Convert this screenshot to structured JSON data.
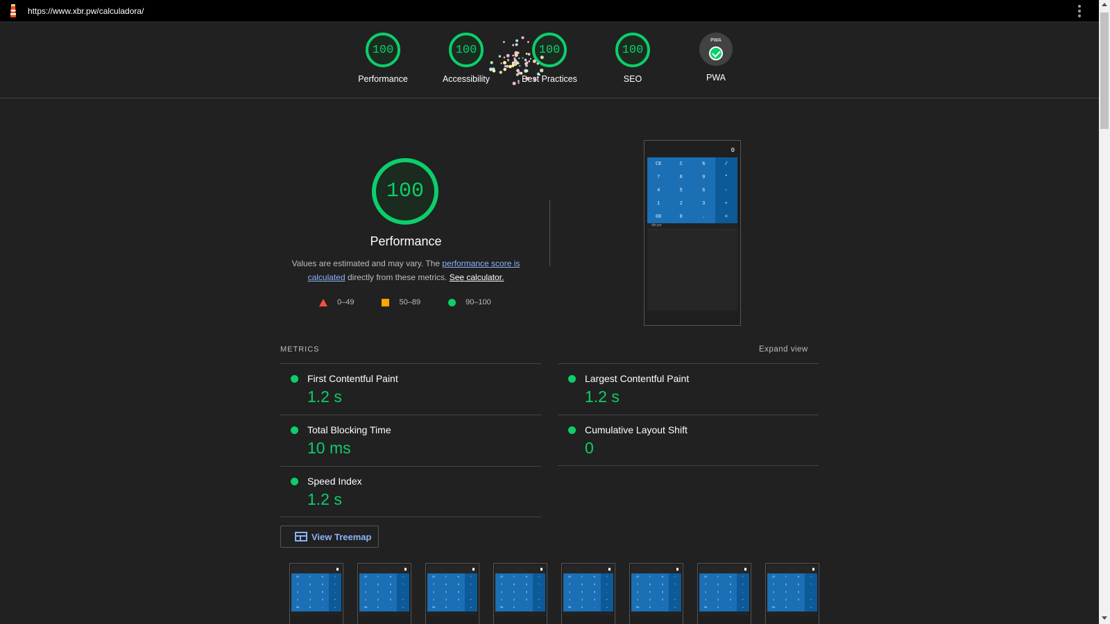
{
  "topbar": {
    "url": "https://www.xbr.pw/calculadora/"
  },
  "header": {
    "categories": [
      {
        "label": "Performance",
        "score": "100"
      },
      {
        "label": "Accessibility",
        "score": "100"
      },
      {
        "label": "Best Practices",
        "score": "100"
      },
      {
        "label": "SEO",
        "score": "100"
      },
      {
        "label": "PWA",
        "badge": "PWA"
      }
    ]
  },
  "performance": {
    "score": "100",
    "title": "Performance",
    "desc_prefix": "Values are estimated and may vary. The ",
    "desc_link": "performance score is calculated",
    "desc_mid": " directly from these metrics. ",
    "desc_link2": "See calculator.",
    "legend": {
      "fail": "0–49",
      "average": "50–89",
      "pass": "90–100"
    }
  },
  "preview": {
    "display": "0",
    "keys": [
      "CE",
      "C",
      "%",
      "/",
      "7",
      "8",
      "9",
      "*",
      "4",
      "5",
      "6",
      "-",
      "1",
      "2",
      "3",
      "+",
      "00",
      "0",
      ".",
      "="
    ],
    "footer": "xbr.pw"
  },
  "metrics": {
    "heading": "METRICS",
    "expand_label": "Expand view",
    "items": [
      {
        "name": "First Contentful Paint",
        "value": "1.2 s"
      },
      {
        "name": "Largest Contentful Paint",
        "value": "1.2 s"
      },
      {
        "name": "Total Blocking Time",
        "value": "10 ms"
      },
      {
        "name": "Cumulative Layout Shift",
        "value": "0"
      },
      {
        "name": "Speed Index",
        "value": "1.2 s"
      }
    ]
  },
  "treemap": {
    "label": "View Treemap"
  },
  "filmstrip": {
    "keys": [
      "CE",
      "C",
      "%",
      "/",
      "7",
      "8",
      "9",
      "*",
      "4",
      "5",
      "6",
      "-",
      "1",
      "2",
      "3",
      "+",
      "00",
      "0",
      ".",
      "="
    ]
  },
  "colors": {
    "pass": "#0cce6b",
    "average": "#ffa400",
    "fail": "#ff4e42",
    "link": "#8ab4f8",
    "background": "#212121"
  }
}
